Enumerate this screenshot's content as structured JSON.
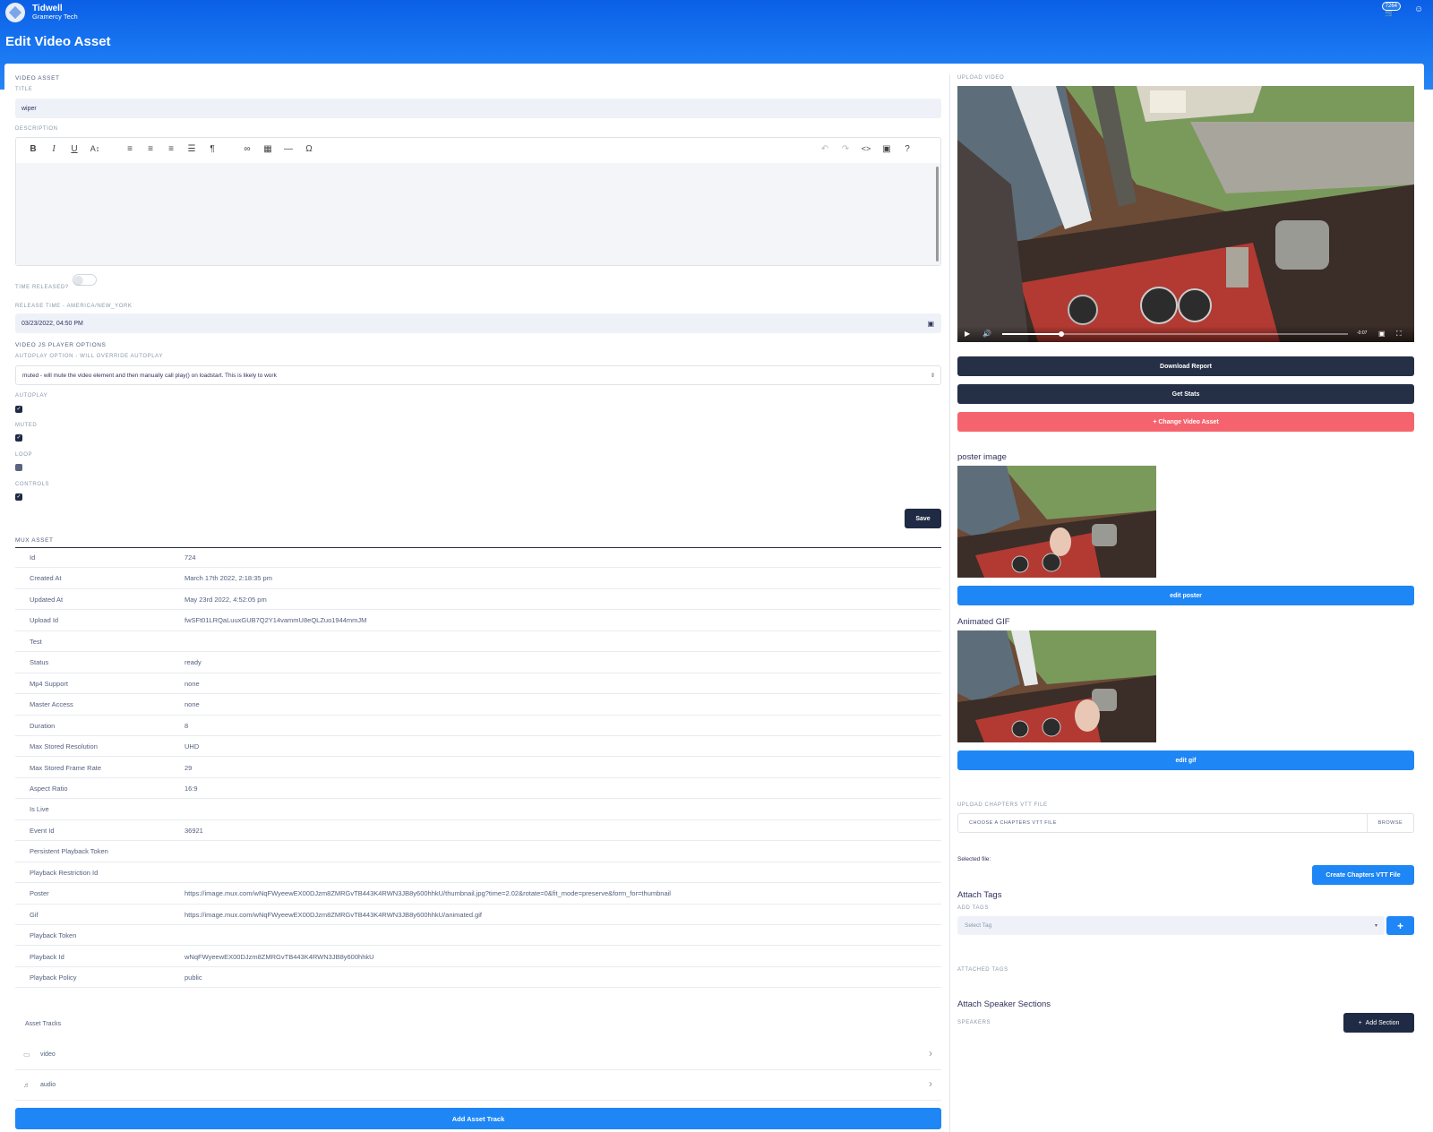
{
  "header": {
    "brand_name": "Tidwell",
    "brand_org": "Gramercy Tech",
    "page_title": "Edit Video Asset",
    "notification_count": "7264",
    "accent_color": "#1a78f2"
  },
  "video_asset": {
    "section_label": "VIDEO ASSET",
    "title_label": "TITLE",
    "title_value": "wiper",
    "description_label": "DESCRIPTION",
    "time_released_label": "TIME RELEASED?",
    "time_released_on": false,
    "release_time_label": "RELEASE TIME - AMERICA/NEW_YORK",
    "release_time_value": "03/23/2022, 04:50 PM",
    "player_options_label": "VIDEO JS PLAYER OPTIONS",
    "autoplay_option_label": "AUTOPLAY OPTION - WILL OVERRIDE AUTOPLAY",
    "autoplay_option_value": "muted - will mute the video element and then manually call play() on loadstart. This is likely to work",
    "autoplay_label": "AUTOPLAY",
    "autoplay_checked": true,
    "muted_label": "MUTED",
    "muted_checked": true,
    "loop_label": "LOOP",
    "loop_checked": false,
    "controls_label": "CONTROLS",
    "controls_checked": true,
    "save_label": "Save"
  },
  "editor_toolbar": [
    "bold-icon",
    "italic-icon",
    "underline-icon",
    "font-size-icon",
    "align-left-icon",
    "align-center-icon",
    "align-right-icon",
    "align-justify-icon",
    "paragraph-icon",
    "link-icon",
    "table-icon",
    "horizontal-rule-icon",
    "special-char-icon",
    "undo-icon",
    "redo-icon",
    "code-view-icon",
    "fullscreen-icon",
    "help-icon"
  ],
  "mux_asset": {
    "section_label": "MUX ASSET",
    "rows": [
      {
        "key": "Id",
        "value": "724"
      },
      {
        "key": "Created At",
        "value": "March 17th 2022, 2:18:35 pm"
      },
      {
        "key": "Updated At",
        "value": "May 23rd 2022, 4:52:05 pm"
      },
      {
        "key": "Upload Id",
        "value": "fwSFt01LRQaLuuxGUB7Q2Y14vammU8eQLZuo1944mmJM"
      },
      {
        "key": "Test",
        "value": ""
      },
      {
        "key": "Status",
        "value": "ready"
      },
      {
        "key": "Mp4 Support",
        "value": "none"
      },
      {
        "key": "Master Access",
        "value": "none"
      },
      {
        "key": "Duration",
        "value": "8"
      },
      {
        "key": "Max Stored Resolution",
        "value": "UHD"
      },
      {
        "key": "Max Stored Frame Rate",
        "value": "29"
      },
      {
        "key": "Aspect Ratio",
        "value": "16:9"
      },
      {
        "key": "Is Live",
        "value": ""
      },
      {
        "key": "Event Id",
        "value": "36921"
      },
      {
        "key": "Persistent Playback Token",
        "value": ""
      },
      {
        "key": "Playback Restriction Id",
        "value": ""
      },
      {
        "key": "Poster",
        "value": "https://image.mux.com/wNqFWyeewEX00DJzm8ZMRGvTB443K4RWN3JB8y600hhkU/thumbnail.jpg?time=2.02&rotate=0&fit_mode=preserve&form_for=thumbnail"
      },
      {
        "key": "Gif",
        "value": "https://image.mux.com/wNqFWyeewEX00DJzm8ZMRGvTB443K4RWN3JB8y600hhkU/animated.gif"
      },
      {
        "key": "Playback Token",
        "value": ""
      },
      {
        "key": "Playback Id",
        "value": "wNqFWyeewEX00DJzm8ZMRGvTB443K4RWN3JB8y600hhkU"
      },
      {
        "key": "Playback Policy",
        "value": "public"
      }
    ],
    "asset_tracks_label": "Asset Tracks",
    "tracks": [
      {
        "name": "video",
        "icon": "video-camera-icon"
      },
      {
        "name": "audio",
        "icon": "speaker-icon"
      }
    ],
    "add_track_label": "Add Asset Track"
  },
  "upload_video": {
    "section_label": "UPLOAD VIDEO",
    "time_remaining": "-0:07",
    "progress": 0.17,
    "download_report_label": "Download Report",
    "get_stats_label": "Get Stats",
    "change_asset_label": "+ Change Video Asset",
    "poster_heading": "poster image",
    "edit_poster_label": "edit poster",
    "gif_heading": "Animated GIF",
    "edit_gif_label": "edit gif",
    "chapters_label": "UPLOAD CHAPTERS VTT FILE",
    "chapters_placeholder": "CHOOSE A CHAPTERS VTT FILE",
    "browse_label": "BROWSE",
    "selected_file_label": "Selected file:",
    "create_chapters_label": "Create Chapters VTT File",
    "attach_tags_heading": "Attach Tags",
    "add_tags_label": "ADD TAGS",
    "select_tag_placeholder": "Select Tag",
    "attached_tags_label": "ATTACHED TAGS",
    "speaker_heading": "Attach Speaker Sections",
    "speakers_label": "SPEAKERS",
    "add_section_label": "Add Section"
  }
}
